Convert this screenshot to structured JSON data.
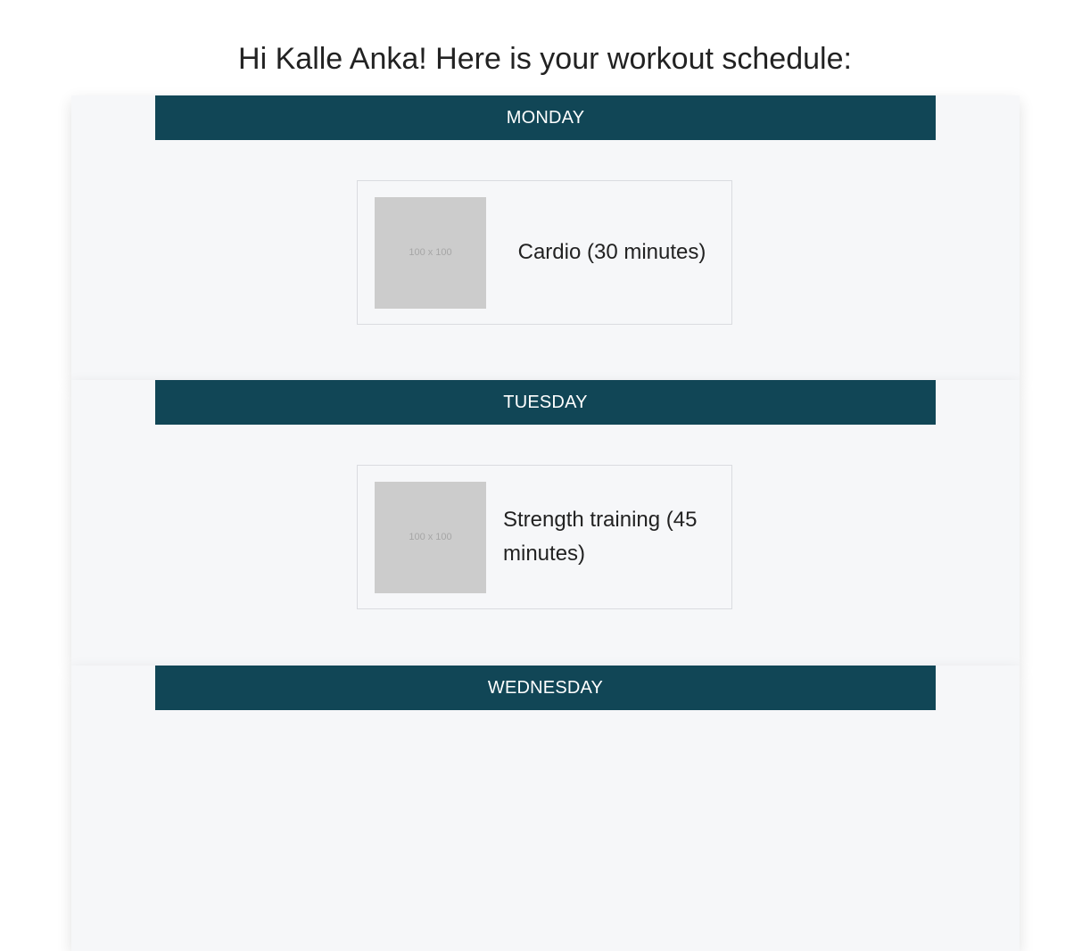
{
  "greeting": "Hi Kalle Anka! Here is your workout schedule:",
  "colors": {
    "header_bg": "#114656",
    "section_bg": "#f6f7f9",
    "placeholder_bg": "#cccccc"
  },
  "days": [
    {
      "name": "MONDAY",
      "workout": {
        "image_placeholder": "100 x 100",
        "label": "Cardio (30 minutes)"
      }
    },
    {
      "name": "TUESDAY",
      "workout": {
        "image_placeholder": "100 x 100",
        "label": "Strength training (45 minutes)"
      }
    },
    {
      "name": "WEDNESDAY"
    }
  ]
}
